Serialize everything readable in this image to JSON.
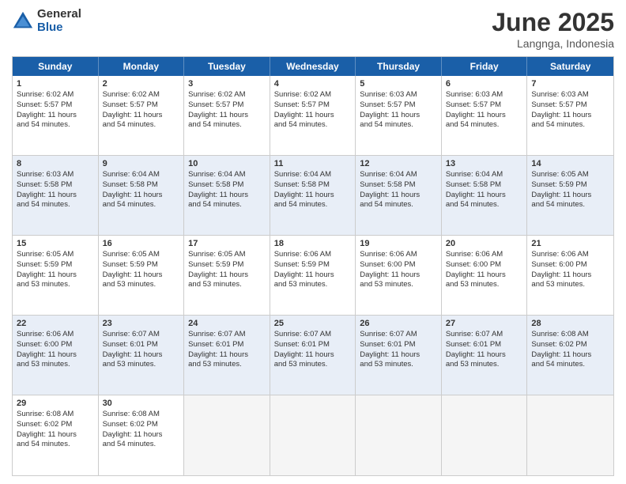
{
  "logo": {
    "general": "General",
    "blue": "Blue"
  },
  "title": "June 2025",
  "location": "Langnga, Indonesia",
  "days": [
    "Sunday",
    "Monday",
    "Tuesday",
    "Wednesday",
    "Thursday",
    "Friday",
    "Saturday"
  ],
  "rows": [
    [
      {
        "day": "1",
        "lines": [
          "Sunrise: 6:02 AM",
          "Sunset: 5:57 PM",
          "Daylight: 11 hours",
          "and 54 minutes."
        ]
      },
      {
        "day": "2",
        "lines": [
          "Sunrise: 6:02 AM",
          "Sunset: 5:57 PM",
          "Daylight: 11 hours",
          "and 54 minutes."
        ]
      },
      {
        "day": "3",
        "lines": [
          "Sunrise: 6:02 AM",
          "Sunset: 5:57 PM",
          "Daylight: 11 hours",
          "and 54 minutes."
        ]
      },
      {
        "day": "4",
        "lines": [
          "Sunrise: 6:02 AM",
          "Sunset: 5:57 PM",
          "Daylight: 11 hours",
          "and 54 minutes."
        ]
      },
      {
        "day": "5",
        "lines": [
          "Sunrise: 6:03 AM",
          "Sunset: 5:57 PM",
          "Daylight: 11 hours",
          "and 54 minutes."
        ]
      },
      {
        "day": "6",
        "lines": [
          "Sunrise: 6:03 AM",
          "Sunset: 5:57 PM",
          "Daylight: 11 hours",
          "and 54 minutes."
        ]
      },
      {
        "day": "7",
        "lines": [
          "Sunrise: 6:03 AM",
          "Sunset: 5:57 PM",
          "Daylight: 11 hours",
          "and 54 minutes."
        ]
      }
    ],
    [
      {
        "day": "8",
        "lines": [
          "Sunrise: 6:03 AM",
          "Sunset: 5:58 PM",
          "Daylight: 11 hours",
          "and 54 minutes."
        ]
      },
      {
        "day": "9",
        "lines": [
          "Sunrise: 6:04 AM",
          "Sunset: 5:58 PM",
          "Daylight: 11 hours",
          "and 54 minutes."
        ]
      },
      {
        "day": "10",
        "lines": [
          "Sunrise: 6:04 AM",
          "Sunset: 5:58 PM",
          "Daylight: 11 hours",
          "and 54 minutes."
        ]
      },
      {
        "day": "11",
        "lines": [
          "Sunrise: 6:04 AM",
          "Sunset: 5:58 PM",
          "Daylight: 11 hours",
          "and 54 minutes."
        ]
      },
      {
        "day": "12",
        "lines": [
          "Sunrise: 6:04 AM",
          "Sunset: 5:58 PM",
          "Daylight: 11 hours",
          "and 54 minutes."
        ]
      },
      {
        "day": "13",
        "lines": [
          "Sunrise: 6:04 AM",
          "Sunset: 5:58 PM",
          "Daylight: 11 hours",
          "and 54 minutes."
        ]
      },
      {
        "day": "14",
        "lines": [
          "Sunrise: 6:05 AM",
          "Sunset: 5:59 PM",
          "Daylight: 11 hours",
          "and 54 minutes."
        ]
      }
    ],
    [
      {
        "day": "15",
        "lines": [
          "Sunrise: 6:05 AM",
          "Sunset: 5:59 PM",
          "Daylight: 11 hours",
          "and 53 minutes."
        ]
      },
      {
        "day": "16",
        "lines": [
          "Sunrise: 6:05 AM",
          "Sunset: 5:59 PM",
          "Daylight: 11 hours",
          "and 53 minutes."
        ]
      },
      {
        "day": "17",
        "lines": [
          "Sunrise: 6:05 AM",
          "Sunset: 5:59 PM",
          "Daylight: 11 hours",
          "and 53 minutes."
        ]
      },
      {
        "day": "18",
        "lines": [
          "Sunrise: 6:06 AM",
          "Sunset: 5:59 PM",
          "Daylight: 11 hours",
          "and 53 minutes."
        ]
      },
      {
        "day": "19",
        "lines": [
          "Sunrise: 6:06 AM",
          "Sunset: 6:00 PM",
          "Daylight: 11 hours",
          "and 53 minutes."
        ]
      },
      {
        "day": "20",
        "lines": [
          "Sunrise: 6:06 AM",
          "Sunset: 6:00 PM",
          "Daylight: 11 hours",
          "and 53 minutes."
        ]
      },
      {
        "day": "21",
        "lines": [
          "Sunrise: 6:06 AM",
          "Sunset: 6:00 PM",
          "Daylight: 11 hours",
          "and 53 minutes."
        ]
      }
    ],
    [
      {
        "day": "22",
        "lines": [
          "Sunrise: 6:06 AM",
          "Sunset: 6:00 PM",
          "Daylight: 11 hours",
          "and 53 minutes."
        ]
      },
      {
        "day": "23",
        "lines": [
          "Sunrise: 6:07 AM",
          "Sunset: 6:01 PM",
          "Daylight: 11 hours",
          "and 53 minutes."
        ]
      },
      {
        "day": "24",
        "lines": [
          "Sunrise: 6:07 AM",
          "Sunset: 6:01 PM",
          "Daylight: 11 hours",
          "and 53 minutes."
        ]
      },
      {
        "day": "25",
        "lines": [
          "Sunrise: 6:07 AM",
          "Sunset: 6:01 PM",
          "Daylight: 11 hours",
          "and 53 minutes."
        ]
      },
      {
        "day": "26",
        "lines": [
          "Sunrise: 6:07 AM",
          "Sunset: 6:01 PM",
          "Daylight: 11 hours",
          "and 53 minutes."
        ]
      },
      {
        "day": "27",
        "lines": [
          "Sunrise: 6:07 AM",
          "Sunset: 6:01 PM",
          "Daylight: 11 hours",
          "and 53 minutes."
        ]
      },
      {
        "day": "28",
        "lines": [
          "Sunrise: 6:08 AM",
          "Sunset: 6:02 PM",
          "Daylight: 11 hours",
          "and 54 minutes."
        ]
      }
    ],
    [
      {
        "day": "29",
        "lines": [
          "Sunrise: 6:08 AM",
          "Sunset: 6:02 PM",
          "Daylight: 11 hours",
          "and 54 minutes."
        ]
      },
      {
        "day": "30",
        "lines": [
          "Sunrise: 6:08 AM",
          "Sunset: 6:02 PM",
          "Daylight: 11 hours",
          "and 54 minutes."
        ]
      },
      {
        "day": "",
        "lines": []
      },
      {
        "day": "",
        "lines": []
      },
      {
        "day": "",
        "lines": []
      },
      {
        "day": "",
        "lines": []
      },
      {
        "day": "",
        "lines": []
      }
    ]
  ],
  "alt_rows": [
    1,
    3
  ]
}
